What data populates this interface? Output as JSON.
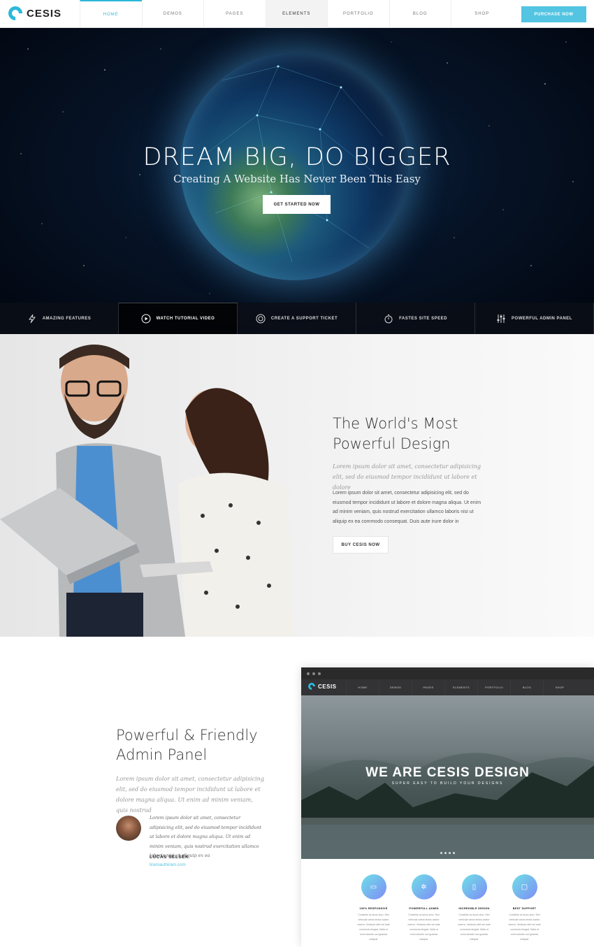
{
  "nav": {
    "logo": "CESIS",
    "items": [
      "HOME",
      "DEMOS",
      "PAGES",
      "ELEMENTS",
      "PORTFOLIO",
      "BLOG",
      "SHOP"
    ],
    "cta": "PURCHASE NOW"
  },
  "hero": {
    "title": "DREAM BIG, DO BIGGER",
    "subtitle": "Creating A Website Has Never Been This Easy",
    "cta": "GET STARTED NOW",
    "features": [
      {
        "label": "AMAZING FEATURES",
        "icon": "lightning-icon"
      },
      {
        "label": "WATCH TUTORIAL VIDEO",
        "icon": "play-icon"
      },
      {
        "label": "CREATE A SUPPORT TICKET",
        "icon": "lifebuoy-icon"
      },
      {
        "label": "FASTES SITE SPEED",
        "icon": "stopwatch-icon"
      },
      {
        "label": "POWERFUL ADMIN PANEL",
        "icon": "sliders-icon"
      }
    ]
  },
  "design": {
    "title_line1": "The World's Most",
    "title_line2": "Powerful Design",
    "lead": "Lorem ipsum dolor sit amet, consectetur adipisicing elit, sed do eiusmod tempor incididunt ut labore et dolore",
    "body": "Lorem ipsum dolor sit amet, consectetur adipisicing elit, sed do eiusmod tempor incididunt ut labore et dolore magna aliqua. Ut enim ad minim veniam, quis nostrud exercitation ullamco laboris nisi ut aliquip ex ea commodo consequat. Duis aute irure dolor in",
    "cta": "BUY CESIS NOW"
  },
  "admin": {
    "title_line1": "Powerful & Friendly",
    "title_line2": "Admin Panel",
    "lead": "Lorem ipsum dolor sit amet, consectetur adipisicing elit, sed do eiusmod tempor incididunt ut labore et dolore magna aliqua. Ut enim ad minim veniam, quis nostrud",
    "quote": "Lorem ipsum dolor sit amet, consectetur adipisicing elit, sed do eiusmod tempor incididunt ut labore et dolore magna aliqua. Ut enim ad minim veniam, quis nostrud exercitation ullamco laboris nisi ut aliquip ex ea",
    "author": "LUCAS SELSEK",
    "author_link": "liramauthiram.com"
  },
  "mockup": {
    "logo": "CESIS",
    "menu": [
      "HOME",
      "DEMOS",
      "PAGES",
      "ELEMENTS",
      "PORTFOLIO",
      "BLOG",
      "SHOP"
    ],
    "hero_title": "WE ARE CESIS DESIGN",
    "hero_sub": "SUPER EASY TO BUILD YOUR DESIGNS",
    "features": [
      {
        "title": "100% RESPONSIVE",
        "icon": "monitor-icon",
        "text": "Curabitur ac lacus arcu. Sed vehicula varius lectus auctor viverra. Vehicula nibh vel ante commodo feugiat. Nulla ut enim lobortis orci gravida volutpat."
      },
      {
        "title": "POWERFULL ADMIN",
        "icon": "gear-icon",
        "text": "Curabitur ac lacus arcu. Sed vehicula varius lectus auctor viverra. Vehicula nibh vel ante commodo feugiat. Nulla ut enim lobortis orci gravida volutpat."
      },
      {
        "title": "INCREDIBLE DESIGN",
        "icon": "book-icon",
        "text": "Curabitur ac lacus arcu. Sed vehicula varius lectus auctor viverra. Vehicula nibh vel ante commodo feugiat. Nulla ut enim lobortis orci gravida volutpat."
      },
      {
        "title": "BEST SUPPORT",
        "icon": "chat-icon",
        "text": "Curabitur ac lacus arcu. Sed vehicula varius lectus auctor viverra. Vehicula nibh vel ante commodo feugiat. Nulla ut enim lobortis orci gravida volutpat."
      }
    ]
  },
  "colors": {
    "accent": "#53c4e2",
    "dark": "#222222"
  }
}
